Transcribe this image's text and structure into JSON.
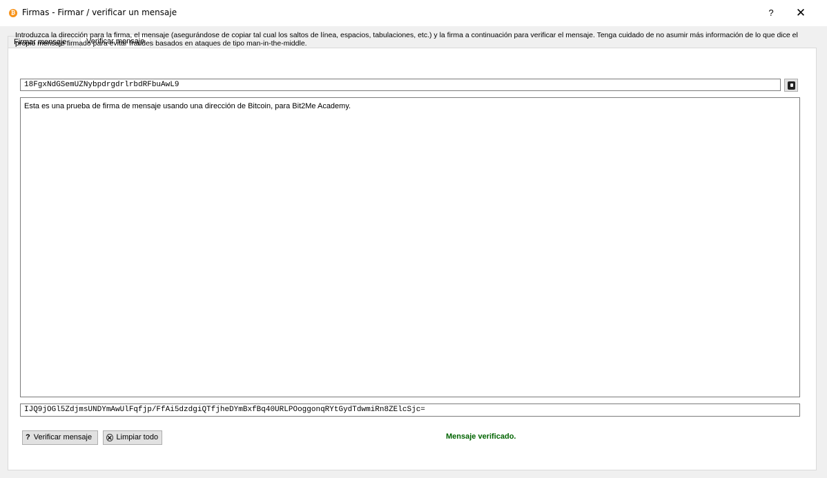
{
  "window": {
    "title": "Firmas - Firmar / verificar un mensaje",
    "help_label": "?",
    "close_label": "✕"
  },
  "tabs": [
    {
      "label": "Firmar mensaje",
      "active": false
    },
    {
      "label": "Verificar mensaje",
      "active": true
    }
  ],
  "verify": {
    "instructions": "Introduzca la dirección para la firma, el mensaje (asegurándose de copiar tal cual los saltos de línea, espacios, tabulaciones, etc.) y la firma a continuación para verificar el mensaje. Tenga cuidado de no asumir más información de lo que dice el propio mensaje firmado para evitar fraudes basados en ataques de tipo man-in-the-middle.",
    "address": "18FgxNdGSemUZNybpdrgdrlrbdRFbuAwL9",
    "message": "Esta es una prueba de firma de mensaje usando una dirección de Bitcoin, para Bit2Me Academy.",
    "signature": "IJQ9jOGl5ZdjmsUNDYmAwUlFqfjp/FfAi5dzdgiQTfjheDYmBxfBq40URLPOoggonqRYtGydTdwmiRn8ZElcSjc=",
    "verify_button_label": "Verificar mensaje",
    "clear_button_label": "Limpiar todo",
    "status": "Mensaje verificado."
  },
  "colors": {
    "app_icon": "#f7931a",
    "status_ok": "#006400"
  }
}
